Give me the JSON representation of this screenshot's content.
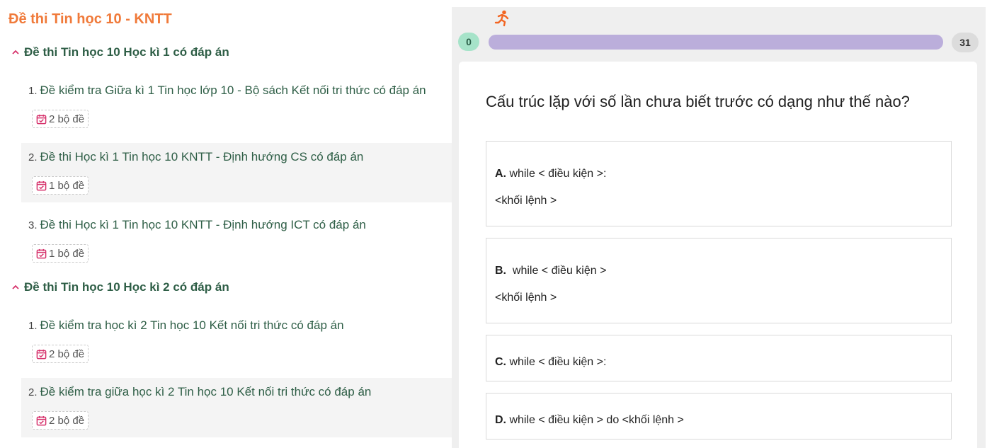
{
  "sidebar": {
    "title": "Đề thi Tin học 10 - KNTT",
    "sections": [
      {
        "label": "Đề thi Tin học 10 Học kì 1 có đáp án",
        "items": [
          {
            "num": "1.",
            "title": "Đề kiểm tra Giữa kì 1 Tin học lớp 10 - Bộ sách Kết nối tri thức có đáp án",
            "badge": "2 bộ đề"
          },
          {
            "num": "2.",
            "title": "Đề thi Học kì 1 Tin học 10 KNTT - Định hướng CS có đáp án",
            "badge": "1 bộ đề"
          },
          {
            "num": "3.",
            "title": "Đề thi Học kì 1 Tin học 10 KNTT - Định hướng ICT có đáp án",
            "badge": "1 bộ đề"
          }
        ]
      },
      {
        "label": "Đề thi Tin học 10 Học kì 2 có đáp án",
        "items": [
          {
            "num": "1.",
            "title": "Đề kiểm tra học kì 2 Tin học 10 Kết nối tri thức có đáp án",
            "badge": "2 bộ đề"
          },
          {
            "num": "2.",
            "title": "Đề kiểm tra giữa học kì 2 Tin học 10 Kết nối tri thức có đáp án",
            "badge": "2 bộ đề"
          }
        ]
      }
    ]
  },
  "quiz": {
    "progress": {
      "current": "0",
      "total": "31",
      "fill_fraction": 1.0
    },
    "question": "Cấu trúc lặp với số lần chưa biết trước có dạng như thế nào?",
    "options": [
      {
        "letter": "A.",
        "lines": [
          "while < điều kiện >:",
          "<khối lệnh >"
        ]
      },
      {
        "letter": "B.",
        "lines": [
          " while < điều kiện >",
          "<khối lệnh >"
        ]
      },
      {
        "letter": "C.",
        "lines": [
          "while < điều kiện >:"
        ]
      },
      {
        "letter": "D.",
        "lines": [
          "while < điều kiện > do <khối lệnh >"
        ]
      }
    ]
  },
  "colors": {
    "title_orange": "#f07a3a",
    "link_green": "#2e5e46",
    "badge_icon_red": "#d6336c",
    "progress_fill": "#bbaedb",
    "start_badge": "#a6e3c9"
  },
  "icons": [
    "chevron-up-icon",
    "calendar-check-icon",
    "runner-icon"
  ]
}
